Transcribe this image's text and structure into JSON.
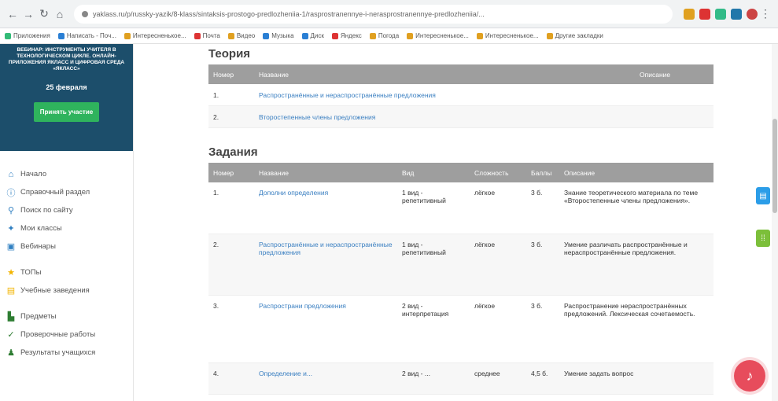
{
  "browser": {
    "url": "yaklass.ru/p/russky-yazik/8-klass/sintaksis-prostogo-predlozheniia-1/rasprostranennye-i-nerasprostranennye-predlozheniia/...",
    "bookmarks": [
      "Приложения",
      "Написать - Поч...",
      "Интересненькое...",
      "Почта",
      "Видео",
      "Музыка",
      "Диск",
      "Яндекс",
      "Погода",
      "Интересненькое...",
      "Интересненькое...",
      "Другие закладки"
    ]
  },
  "sidebar": {
    "promo_text": "Вебинар: инструменты учителя в технологическом цикле. Онлайн-приложения ЯКласс и цифровая среда «ЯКласс»",
    "promo_date": "25 февраля",
    "promo_button": "Принять участие",
    "menu": [
      {
        "icon": "home-icon",
        "label": "Начало",
        "color": "#2f7fc1",
        "glyph": "⌂"
      },
      {
        "icon": "info-icon",
        "label": "Справочный раздел",
        "color": "#2f7fc1",
        "glyph": "ⓘ"
      },
      {
        "icon": "search-icon",
        "label": "Поиск по сайту",
        "color": "#2f7fc1",
        "glyph": "⚲"
      },
      {
        "icon": "classes-icon",
        "label": "Мои классы",
        "color": "#2f7fc1",
        "glyph": "✦"
      },
      {
        "icon": "webinar-icon",
        "label": "Вебинары",
        "color": "#2f7fc1",
        "glyph": "▣"
      },
      {
        "icon": "star-icon",
        "label": "ТОПы",
        "color": "#f2b400",
        "glyph": "★"
      },
      {
        "icon": "school-icon",
        "label": "Учебные заведения",
        "color": "#f2b400",
        "glyph": "▤"
      },
      {
        "icon": "subjects-icon",
        "label": "Предметы",
        "color": "#2e7d32",
        "glyph": "▙"
      },
      {
        "icon": "check-icon",
        "label": "Проверочные работы",
        "color": "#2e7d32",
        "glyph": "✓"
      },
      {
        "icon": "results-icon",
        "label": "Результаты учащихся",
        "color": "#2e7d32",
        "glyph": "♟"
      }
    ]
  },
  "theory": {
    "title": "Теория",
    "headers": {
      "num": "Номер",
      "name": "Название",
      "desc": "Описание"
    },
    "rows": [
      {
        "num": "1.",
        "name": "Распространённые и нераспространённые предложения"
      },
      {
        "num": "2.",
        "name": "Второстепенные члены предложения"
      }
    ]
  },
  "tasks": {
    "title": "Задания",
    "headers": {
      "num": "Номер",
      "name": "Название",
      "type": "Вид",
      "difficulty": "Сложность",
      "points": "Баллы",
      "desc": "Описание"
    },
    "rows": [
      {
        "num": "1.",
        "name": "Дополни определения",
        "type": "1 вид - репетитивный",
        "difficulty": "лёгкое",
        "points": "3 б.",
        "desc": "Знание теоретического материала по теме «Второстепенные члены предложения»."
      },
      {
        "num": "2.",
        "name": "Распространённые и нераспространённые предложения",
        "type": "1 вид - репетитивный",
        "difficulty": "лёгкое",
        "points": "3 б.",
        "desc": "Умение различать распространённые и нераспространённые предложения."
      },
      {
        "num": "3.",
        "name": "Распространи предложения",
        "type": "2 вид - интерпретация",
        "difficulty": "лёгкое",
        "points": "3 б.",
        "desc": "Распространение нераспространённых предложений. Лексическая сочетаемость."
      },
      {
        "num": "4.",
        "name": "Определение и...",
        "type": "2 вид - ...",
        "difficulty": "среднее",
        "points": "4,5 б.",
        "desc": "Умение задать вопрос"
      }
    ]
  }
}
